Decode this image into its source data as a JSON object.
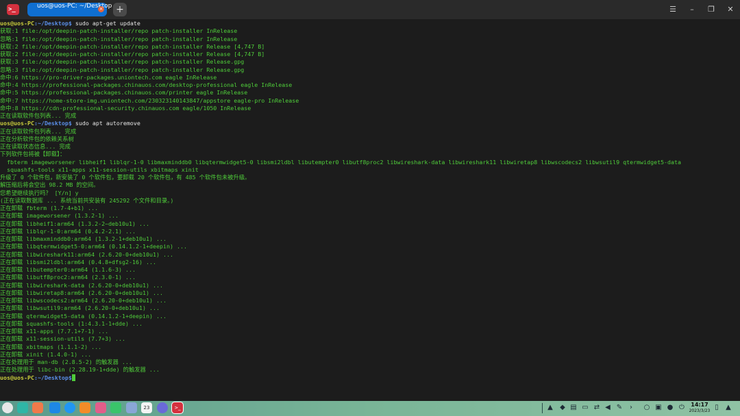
{
  "window": {
    "tab_title": "uos@uos-PC: ~/Desktop",
    "new_tab_label": "+",
    "menu_icon": "menu-icon",
    "minimize_icon": "minimize-icon",
    "maximize_icon": "maximize-icon",
    "close_icon": "close-icon"
  },
  "terminal": {
    "lines": [
      {
        "type": "prompt",
        "user": "uos@uos-PC",
        "path": ":~/Desktop",
        "sym": "$ ",
        "cmd": "sudo apt-get update"
      },
      {
        "type": "out",
        "text": "获取:1 file:/opt/deepin-patch-installer/repo patch-installer InRelease"
      },
      {
        "type": "out",
        "text": "忽略:1 file:/opt/deepin-patch-installer/repo patch-installer InRelease"
      },
      {
        "type": "out",
        "text": "获取:2 file:/opt/deepin-patch-installer/repo patch-installer Release [4,747 B]"
      },
      {
        "type": "out",
        "text": "获取:2 file:/opt/deepin-patch-installer/repo patch-installer Release [4,747 B]"
      },
      {
        "type": "out",
        "text": "获取:3 file:/opt/deepin-patch-installer/repo patch-installer Release.gpg"
      },
      {
        "type": "out",
        "text": "忽略:3 file:/opt/deepin-patch-installer/repo patch-installer Release.gpg"
      },
      {
        "type": "out",
        "text": "命中:6 https://pro-driver-packages.uniontech.com eagle InRelease"
      },
      {
        "type": "out",
        "text": "命中:4 https://professional-packages.chinauos.com/desktop-professional eagle InRelease"
      },
      {
        "type": "out",
        "text": "命中:5 https://professional-packages.chinauos.com/printer eagle InRelease"
      },
      {
        "type": "out",
        "text": "命中:7 https://home-store-img.uniontech.com/230323140143847/appstore eagle-pro InRelease"
      },
      {
        "type": "out",
        "text": "命中:8 https://cdn-professional-security.chinauos.com eagle/1050 InRelease"
      },
      {
        "type": "out",
        "text": "正在读取软件包列表... 完成"
      },
      {
        "type": "prompt",
        "user": "uos@uos-PC",
        "path": ":~/Desktop",
        "sym": "$ ",
        "cmd": "sudo apt autoremove"
      },
      {
        "type": "out",
        "text": "正在读取软件包列表... 完成"
      },
      {
        "type": "out",
        "text": "正在分析软件包的依赖关系树"
      },
      {
        "type": "out",
        "text": "正在读取状态信息... 完成"
      },
      {
        "type": "out",
        "text": "下列软件包将被【卸载】："
      },
      {
        "type": "out",
        "text": "  fbterm imageworsener libheif1 liblqr-1-0 libmaxminddb0 libqtermwidget5-0 libsmi2ldbl libutempter0 libutf8proc2 libwireshark-data libwireshark11 libwiretap8 libwscodecs2 libwsutil9 qtermwidget5-data"
      },
      {
        "type": "out",
        "text": "  squashfs-tools x11-apps x11-session-utils xbitmaps xinit"
      },
      {
        "type": "out",
        "text": "升级了 0 个软件包，新安装了 0 个软件包，要卸载 20 个软件包，有 485 个软件包未被升级。"
      },
      {
        "type": "out",
        "text": "解压缩后将会空出 98.2 MB 的空间。"
      },
      {
        "type": "out",
        "text": "您希望继续执行吗？ [Y/n] y"
      },
      {
        "type": "out",
        "text": "(正在读取数据库 ... 系统当前共安装有 245292 个文件和目录。)"
      },
      {
        "type": "out",
        "text": "正在卸载 fbterm (1.7-4+b1) ..."
      },
      {
        "type": "out",
        "text": "正在卸载 imageworsener (1.3.2-1) ..."
      },
      {
        "type": "out",
        "text": "正在卸载 libheif1:arm64 (1.3.2-2~deb10u1) ..."
      },
      {
        "type": "out",
        "text": "正在卸载 liblqr-1-0:arm64 (0.4.2-2.1) ..."
      },
      {
        "type": "out",
        "text": "正在卸载 libmaxminddb0:arm64 (1.3.2-1+deb10u1) ..."
      },
      {
        "type": "out",
        "text": "正在卸载 libqtermwidget5-0:arm64 (0.14.1.2-1+deepin) ..."
      },
      {
        "type": "out",
        "text": "正在卸载 libwireshark11:arm64 (2.6.20-0+deb10u1) ..."
      },
      {
        "type": "out",
        "text": "正在卸载 libsmi2ldbl:arm64 (0.4.8+dfsg2-16) ..."
      },
      {
        "type": "out",
        "text": "正在卸载 libutempter0:arm64 (1.1.6-3) ..."
      },
      {
        "type": "out",
        "text": "正在卸载 libutf8proc2:arm64 (2.3.0-1) ..."
      },
      {
        "type": "out",
        "text": "正在卸载 libwireshark-data (2.6.20-0+deb10u1) ..."
      },
      {
        "type": "out",
        "text": "正在卸载 libwiretap8:arm64 (2.6.20-0+deb10u1) ..."
      },
      {
        "type": "out",
        "text": "正在卸载 libwscodecs2:arm64 (2.6.20-0+deb10u1) ..."
      },
      {
        "type": "out",
        "text": "正在卸载 libwsutil9:arm64 (2.6.20-0+deb10u1) ..."
      },
      {
        "type": "out",
        "text": "正在卸载 qtermwidget5-data (0.14.1.2-1+deepin) ..."
      },
      {
        "type": "out",
        "text": "正在卸载 squashfs-tools (1:4.3.1-1+dde) ..."
      },
      {
        "type": "out",
        "text": "正在卸载 x11-apps (7.7.1+7-1) ..."
      },
      {
        "type": "out",
        "text": "正在卸载 x11-session-utils (7.7+3) ..."
      },
      {
        "type": "out",
        "text": "正在卸载 xbitmaps (1.1.1-2) ..."
      },
      {
        "type": "out",
        "text": "正在卸载 xinit (1.4.0-1) ..."
      },
      {
        "type": "out",
        "text": "正在处理用于 man-db (2.8.5-2) 的触发器 ..."
      },
      {
        "type": "out",
        "text": "正在处理用于 libc-bin (2.28.19-1+dde) 的触发器 ..."
      },
      {
        "type": "prompt",
        "user": "uos@uos-PC",
        "path": ":~/Desktop",
        "sym": "$",
        "cmd": "",
        "cursor": true
      }
    ]
  },
  "taskbar": {
    "apps": [
      {
        "name": "launcher-icon",
        "color": "#e8e8e8"
      },
      {
        "name": "multitask-view-icon",
        "color": "#2fb6a6"
      },
      {
        "name": "file-manager-icon",
        "color": "#f07a4a"
      },
      {
        "name": "app-store-icon",
        "color": "#1e88e5"
      },
      {
        "name": "browser-icon",
        "color": "#2196f3"
      },
      {
        "name": "archive-manager-icon",
        "color": "#f28c28"
      },
      {
        "name": "photos-icon",
        "color": "#e35d8a"
      },
      {
        "name": "music-icon",
        "color": "#3ac46a"
      },
      {
        "name": "document-viewer-icon",
        "color": "#8aa6d6"
      },
      {
        "name": "calendar-icon",
        "color": "#f4f4f4"
      },
      {
        "name": "settings-icon",
        "color": "#6a6ad8"
      },
      {
        "name": "terminal-icon",
        "color": "#d4313e"
      }
    ],
    "tray": [
      {
        "name": "pin-icon",
        "glyph": "▲"
      },
      {
        "name": "security-icon",
        "glyph": "◆"
      },
      {
        "name": "printer-icon",
        "glyph": "▤"
      },
      {
        "name": "keyboard-icon",
        "glyph": "▭"
      },
      {
        "name": "transfer-icon",
        "glyph": "⇄"
      },
      {
        "name": "volume-icon",
        "glyph": "◀"
      },
      {
        "name": "pen-icon",
        "glyph": "✎"
      },
      {
        "name": "expand-tray-icon",
        "glyph": "›"
      },
      {
        "name": "search-icon",
        "glyph": "○"
      },
      {
        "name": "notification-center-icon",
        "glyph": "▣"
      },
      {
        "name": "network-icon",
        "glyph": "●"
      },
      {
        "name": "power-icon",
        "glyph": "⏻"
      },
      {
        "name": "trash-icon",
        "glyph": "▯"
      },
      {
        "name": "bell-icon",
        "glyph": "▲"
      }
    ],
    "clock_time": "14:17",
    "clock_date": "2023/3/23",
    "calendar_day": "23"
  }
}
